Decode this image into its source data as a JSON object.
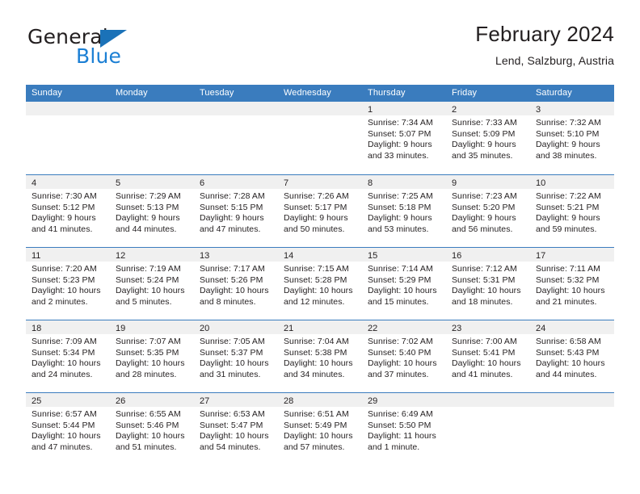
{
  "brand": {
    "name_part1": "General",
    "name_part2": "Blue",
    "triangle_color": "#1b72b8",
    "blue_text_color": "#1b7fd4"
  },
  "header": {
    "title": "February 2024",
    "subtitle": "Lend, Salzburg, Austria"
  },
  "theme": {
    "header_row_bg": "#3a7cbe",
    "header_row_text": "#ffffff",
    "day_number_band_bg": "#f0f0f0",
    "grid_line": "#3a7cbe",
    "body_text": "#231f20"
  },
  "weekdays": [
    "Sunday",
    "Monday",
    "Tuesday",
    "Wednesday",
    "Thursday",
    "Friday",
    "Saturday"
  ],
  "weeks": [
    [
      {
        "day": "",
        "lines": []
      },
      {
        "day": "",
        "lines": []
      },
      {
        "day": "",
        "lines": []
      },
      {
        "day": "",
        "lines": []
      },
      {
        "day": "1",
        "lines": [
          "Sunrise: 7:34 AM",
          "Sunset: 5:07 PM",
          "Daylight: 9 hours",
          "and 33 minutes."
        ]
      },
      {
        "day": "2",
        "lines": [
          "Sunrise: 7:33 AM",
          "Sunset: 5:09 PM",
          "Daylight: 9 hours",
          "and 35 minutes."
        ]
      },
      {
        "day": "3",
        "lines": [
          "Sunrise: 7:32 AM",
          "Sunset: 5:10 PM",
          "Daylight: 9 hours",
          "and 38 minutes."
        ]
      }
    ],
    [
      {
        "day": "4",
        "lines": [
          "Sunrise: 7:30 AM",
          "Sunset: 5:12 PM",
          "Daylight: 9 hours",
          "and 41 minutes."
        ]
      },
      {
        "day": "5",
        "lines": [
          "Sunrise: 7:29 AM",
          "Sunset: 5:13 PM",
          "Daylight: 9 hours",
          "and 44 minutes."
        ]
      },
      {
        "day": "6",
        "lines": [
          "Sunrise: 7:28 AM",
          "Sunset: 5:15 PM",
          "Daylight: 9 hours",
          "and 47 minutes."
        ]
      },
      {
        "day": "7",
        "lines": [
          "Sunrise: 7:26 AM",
          "Sunset: 5:17 PM",
          "Daylight: 9 hours",
          "and 50 minutes."
        ]
      },
      {
        "day": "8",
        "lines": [
          "Sunrise: 7:25 AM",
          "Sunset: 5:18 PM",
          "Daylight: 9 hours",
          "and 53 minutes."
        ]
      },
      {
        "day": "9",
        "lines": [
          "Sunrise: 7:23 AM",
          "Sunset: 5:20 PM",
          "Daylight: 9 hours",
          "and 56 minutes."
        ]
      },
      {
        "day": "10",
        "lines": [
          "Sunrise: 7:22 AM",
          "Sunset: 5:21 PM",
          "Daylight: 9 hours",
          "and 59 minutes."
        ]
      }
    ],
    [
      {
        "day": "11",
        "lines": [
          "Sunrise: 7:20 AM",
          "Sunset: 5:23 PM",
          "Daylight: 10 hours",
          "and 2 minutes."
        ]
      },
      {
        "day": "12",
        "lines": [
          "Sunrise: 7:19 AM",
          "Sunset: 5:24 PM",
          "Daylight: 10 hours",
          "and 5 minutes."
        ]
      },
      {
        "day": "13",
        "lines": [
          "Sunrise: 7:17 AM",
          "Sunset: 5:26 PM",
          "Daylight: 10 hours",
          "and 8 minutes."
        ]
      },
      {
        "day": "14",
        "lines": [
          "Sunrise: 7:15 AM",
          "Sunset: 5:28 PM",
          "Daylight: 10 hours",
          "and 12 minutes."
        ]
      },
      {
        "day": "15",
        "lines": [
          "Sunrise: 7:14 AM",
          "Sunset: 5:29 PM",
          "Daylight: 10 hours",
          "and 15 minutes."
        ]
      },
      {
        "day": "16",
        "lines": [
          "Sunrise: 7:12 AM",
          "Sunset: 5:31 PM",
          "Daylight: 10 hours",
          "and 18 minutes."
        ]
      },
      {
        "day": "17",
        "lines": [
          "Sunrise: 7:11 AM",
          "Sunset: 5:32 PM",
          "Daylight: 10 hours",
          "and 21 minutes."
        ]
      }
    ],
    [
      {
        "day": "18",
        "lines": [
          "Sunrise: 7:09 AM",
          "Sunset: 5:34 PM",
          "Daylight: 10 hours",
          "and 24 minutes."
        ]
      },
      {
        "day": "19",
        "lines": [
          "Sunrise: 7:07 AM",
          "Sunset: 5:35 PM",
          "Daylight: 10 hours",
          "and 28 minutes."
        ]
      },
      {
        "day": "20",
        "lines": [
          "Sunrise: 7:05 AM",
          "Sunset: 5:37 PM",
          "Daylight: 10 hours",
          "and 31 minutes."
        ]
      },
      {
        "day": "21",
        "lines": [
          "Sunrise: 7:04 AM",
          "Sunset: 5:38 PM",
          "Daylight: 10 hours",
          "and 34 minutes."
        ]
      },
      {
        "day": "22",
        "lines": [
          "Sunrise: 7:02 AM",
          "Sunset: 5:40 PM",
          "Daylight: 10 hours",
          "and 37 minutes."
        ]
      },
      {
        "day": "23",
        "lines": [
          "Sunrise: 7:00 AM",
          "Sunset: 5:41 PM",
          "Daylight: 10 hours",
          "and 41 minutes."
        ]
      },
      {
        "day": "24",
        "lines": [
          "Sunrise: 6:58 AM",
          "Sunset: 5:43 PM",
          "Daylight: 10 hours",
          "and 44 minutes."
        ]
      }
    ],
    [
      {
        "day": "25",
        "lines": [
          "Sunrise: 6:57 AM",
          "Sunset: 5:44 PM",
          "Daylight: 10 hours",
          "and 47 minutes."
        ]
      },
      {
        "day": "26",
        "lines": [
          "Sunrise: 6:55 AM",
          "Sunset: 5:46 PM",
          "Daylight: 10 hours",
          "and 51 minutes."
        ]
      },
      {
        "day": "27",
        "lines": [
          "Sunrise: 6:53 AM",
          "Sunset: 5:47 PM",
          "Daylight: 10 hours",
          "and 54 minutes."
        ]
      },
      {
        "day": "28",
        "lines": [
          "Sunrise: 6:51 AM",
          "Sunset: 5:49 PM",
          "Daylight: 10 hours",
          "and 57 minutes."
        ]
      },
      {
        "day": "29",
        "lines": [
          "Sunrise: 6:49 AM",
          "Sunset: 5:50 PM",
          "Daylight: 11 hours",
          "and 1 minute."
        ]
      },
      {
        "day": "",
        "lines": []
      },
      {
        "day": "",
        "lines": []
      }
    ]
  ]
}
